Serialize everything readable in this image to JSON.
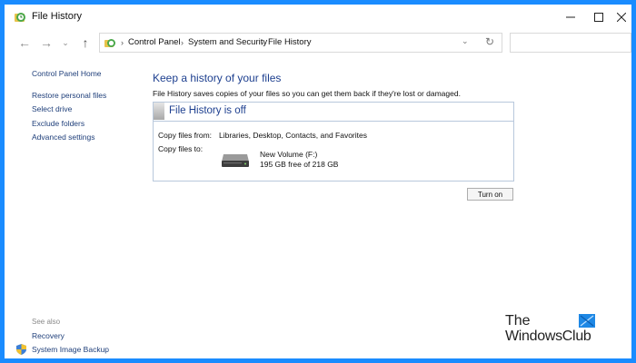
{
  "window": {
    "title": "File History",
    "controls": {
      "minimize": "minimize-icon",
      "maximize": "maximize-icon",
      "close": "close-icon"
    }
  },
  "address_bar": {
    "breadcrumbs": [
      "Control Panel",
      "System and Security",
      "File History"
    ],
    "search_placeholder": ""
  },
  "sidebar": {
    "home_link": "Control Panel Home",
    "links": [
      "Restore personal files",
      "Select drive",
      "Exclude folders",
      "Advanced settings"
    ],
    "see_also_heading": "See also",
    "see_also_links": [
      "Recovery",
      "System Image Backup"
    ]
  },
  "main": {
    "heading": "Keep a history of your files",
    "description": "File History saves copies of your files so you can get them back if they're lost or damaged.",
    "status_title": "File History is off",
    "copy_from_label": "Copy files from:",
    "copy_from_value": "Libraries, Desktop, Contacts, and Favorites",
    "copy_to_label": "Copy files to:",
    "drive_name": "New Volume (F:)",
    "drive_free": "195 GB free of 218 GB",
    "turn_on_button": "Turn on"
  },
  "watermark": {
    "line1": "The",
    "line2": "WindowsClub"
  },
  "colors": {
    "frame_border": "#1a8cff",
    "heading_blue": "#1d3f8f",
    "link_blue": "#1f3f7a"
  }
}
